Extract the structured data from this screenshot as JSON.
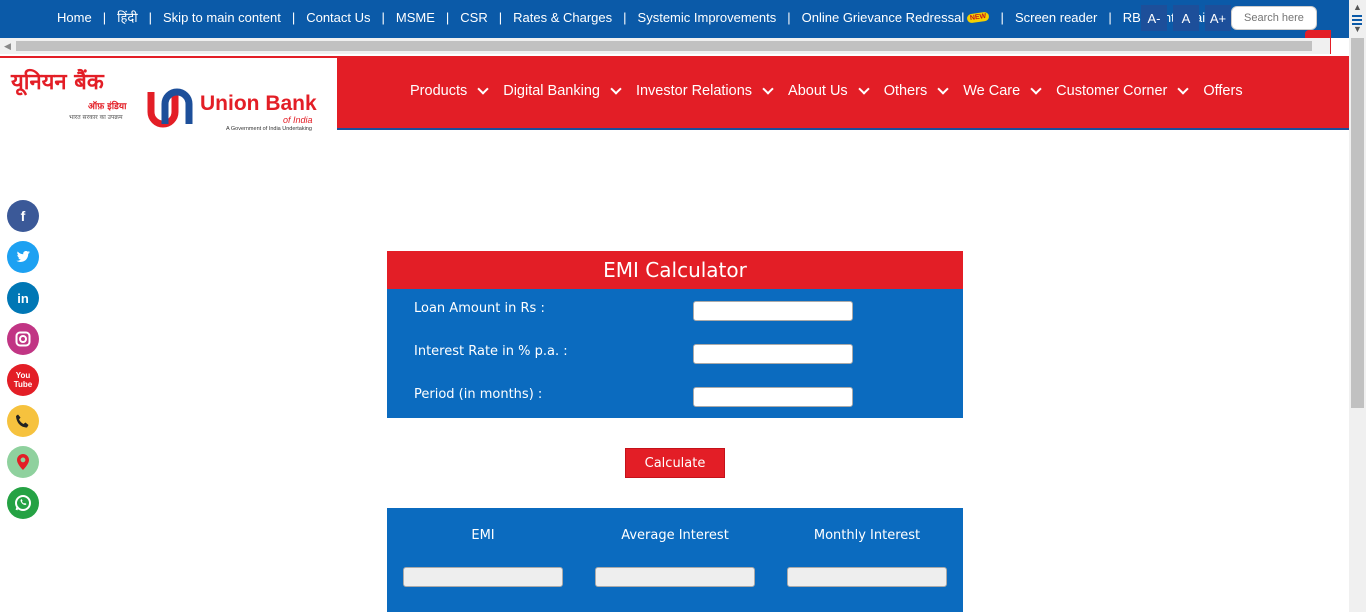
{
  "topbar": {
    "links": [
      "Home",
      "हिंदी",
      "Skip to main content",
      "Contact Us",
      "MSME",
      "CSR",
      "Rates & Charges",
      "Systemic Improvements",
      "Online Grievance Redressal",
      "Screen reader",
      "RBI Kehta Hai"
    ],
    "new_badge": "NEW",
    "font_decrease": "A-",
    "font_normal": "A",
    "font_increase": "A+",
    "search_placeholder": "Search here"
  },
  "header": {
    "logo_hindi": "यूनियन बैंक",
    "logo_hindi_sub": "ऑफ़ इंडिया",
    "logo_hindi_tagline": "भारत सरकार का उपक्रम",
    "logo_english": "Union Bank",
    "logo_english_sub": "of India",
    "logo_english_tagline": "A Government of India Undertaking",
    "nav": [
      "Products",
      "Digital Banking",
      "Investor Relations",
      "About Us",
      "Others",
      "We Care",
      "Customer Corner",
      "Offers"
    ]
  },
  "social": [
    "facebook-icon",
    "twitter-icon",
    "linkedin-icon",
    "instagram-icon",
    "youtube-icon",
    "phone-icon",
    "location-icon",
    "whatsapp-icon"
  ],
  "calculator": {
    "title": "EMI Calculator",
    "loan_label": "Loan Amount in Rs :",
    "rate_label": "Interest Rate in % p.a. :",
    "period_label": "Period (in months) :",
    "button": "Calculate"
  },
  "results": {
    "emi": "EMI",
    "avg_interest": "Average Interest",
    "monthly_interest": "Monthly Interest"
  },
  "colors": {
    "brand_red": "#e31e26",
    "brand_blue": "#0b6bbf",
    "top_blue": "#0b5aa8"
  }
}
